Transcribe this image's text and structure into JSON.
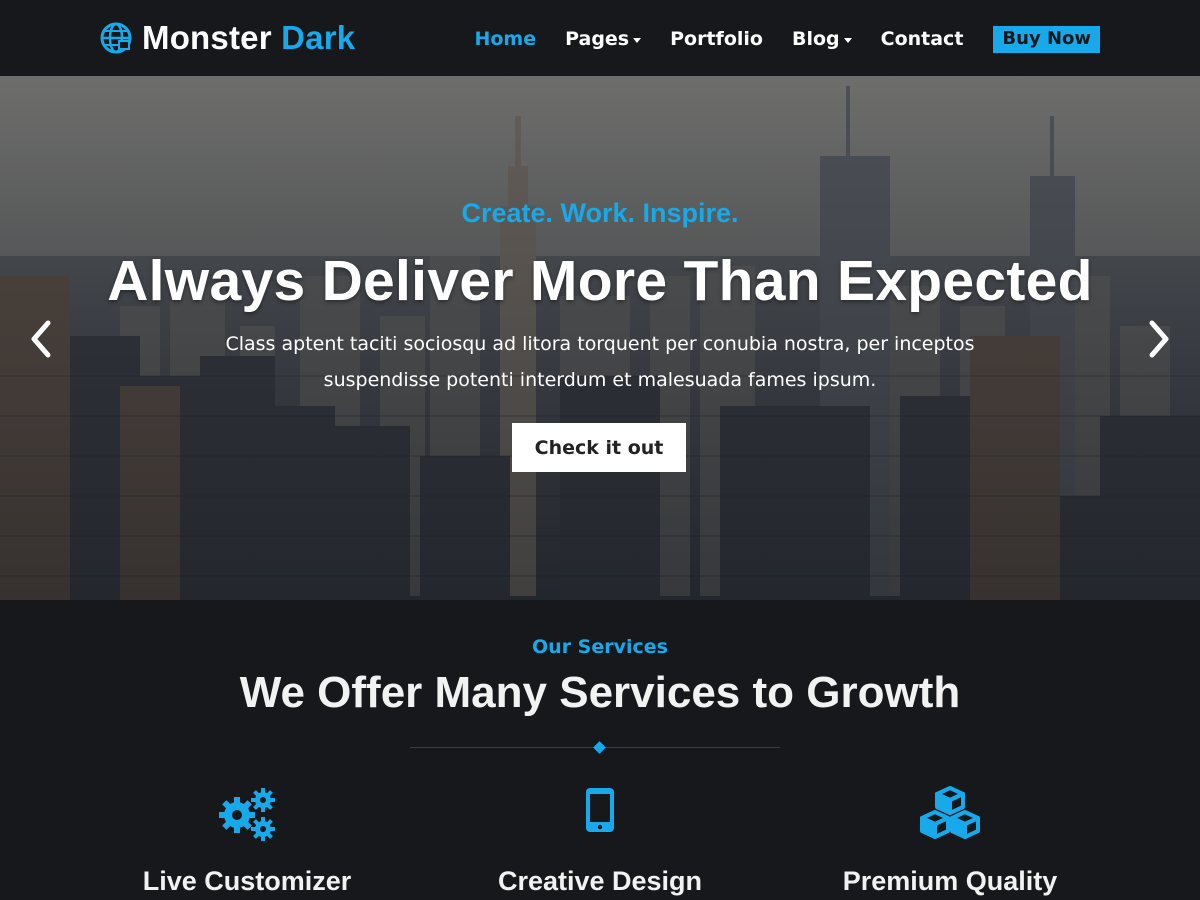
{
  "brand": {
    "name_part1": "Monster",
    "name_part2": "Dark",
    "accent": "#17a9e9",
    "icon": "globe-icon"
  },
  "nav": {
    "home": "Home",
    "pages": "Pages",
    "portfolio": "Portfolio",
    "blog": "Blog",
    "contact": "Contact",
    "buy": "Buy Now"
  },
  "hero": {
    "tagline": "Create. Work. Inspire.",
    "title": "Always Deliver More Than Expected",
    "subtitle_line1": "Class aptent taciti sociosqu ad litora torquent per conubia nostra, per inceptos",
    "subtitle_line2": "suspendisse potenti interdum et malesuada fames ipsum.",
    "cta": "Check it out",
    "prev_icon": "chevron-left-icon",
    "next_icon": "chevron-right-icon"
  },
  "services": {
    "kicker": "Our Services",
    "title": "We Offer Many Services to Growth",
    "items": [
      {
        "name": "Live Customizer",
        "icon": "gears-icon"
      },
      {
        "name": "Creative Design",
        "icon": "mobile-icon"
      },
      {
        "name": "Premium Quality",
        "icon": "cubes-icon"
      }
    ]
  }
}
